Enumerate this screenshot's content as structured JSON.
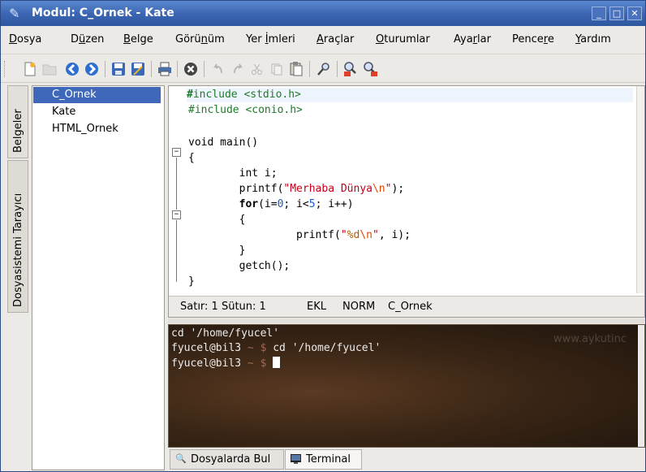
{
  "window": {
    "title": "Modul: C_Ornek - Kate",
    "buttons": {
      "minimize": "_",
      "maximize": "□",
      "close": "✕"
    }
  },
  "menu": {
    "items": [
      {
        "pre": "",
        "u": "D",
        "post": "osya"
      },
      {
        "pre": "D",
        "u": "ü",
        "post": "zen"
      },
      {
        "pre": "",
        "u": "B",
        "post": "elge"
      },
      {
        "pre": "Görü",
        "u": "n",
        "post": "üm"
      },
      {
        "pre": "Yer ",
        "u": "İ",
        "post": "mleri"
      },
      {
        "pre": "",
        "u": "A",
        "post": "raçlar"
      },
      {
        "pre": "",
        "u": "O",
        "post": "turumlar"
      },
      {
        "pre": "Aya",
        "u": "r",
        "post": "lar"
      },
      {
        "pre": "Pence",
        "u": "r",
        "post": "e"
      },
      {
        "pre": "",
        "u": "Y",
        "post": "ardım"
      }
    ]
  },
  "toolbar": {
    "icons": [
      "new-document-icon",
      "open-document-icon",
      "back-icon",
      "forward-icon",
      "save-icon",
      "save-as-icon",
      "print-icon",
      "close-document-icon",
      "undo-icon",
      "redo-icon",
      "cut-icon",
      "copy-icon",
      "paste-icon",
      "search-icon",
      "find-previous-icon",
      "find-next-icon"
    ]
  },
  "side_tabs": {
    "documents": "Belgeler",
    "filesystem": "Dosyasistemi Tarayıcı"
  },
  "documents": [
    "C_Ornek",
    "Kate",
    "HTML_Ornek"
  ],
  "editor": {
    "code": {
      "l1a": "#",
      "l1b": "include <stdio.h>",
      "l2": "#include <conio.h>",
      "l4": "void main()",
      "l5": "{",
      "l6": "        int i;",
      "l7a": "        printf(",
      "l7b": "\"Merhaba Dünya",
      "l7c": "\\n",
      "l7d": "\"",
      "l7e": ");",
      "l8a": "        ",
      "l8b": "for",
      "l8c": "(i=",
      "l8d": "0",
      "l8e": "; i<",
      "l8f": "5",
      "l8g": "; i++)",
      "l9": "        {",
      "l10a": "                 printf(",
      "l10b": "\"",
      "l10c": "%d",
      "l10d": "\\n",
      "l10e": "\"",
      "l10f": ", i);",
      "l11": "        }",
      "l12": "        getch();",
      "l13": "}"
    },
    "status": {
      "position": "Satır: 1 Sütun: 1",
      "mode_ins": "EKL",
      "mode_norm": "NORM",
      "doc": "C_Ornek"
    }
  },
  "terminal": {
    "line1": "cd '/home/fyucel'",
    "user1": "fyucel@bil3",
    "sep1": " ~ $ ",
    "cmd1": "cd '/home/fyucel'",
    "user2": "fyucel@bil3",
    "sep2": " ~ $ ",
    "watermark": "www.aykutinc"
  },
  "bottom_tabs": {
    "find_in_files": "Dosyalarda Bul",
    "terminal": "Terminal"
  },
  "colors": {
    "title_bar": "#3a64b1",
    "selection": "#3f68ba",
    "string": "#c5001a",
    "number": "#1b5bc7"
  }
}
